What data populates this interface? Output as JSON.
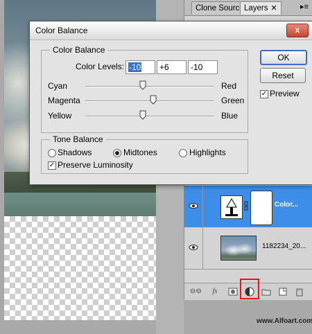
{
  "tabs": {
    "clone_source": "Clone Source",
    "layers": "Layers",
    "close": "✕",
    "more": "▸≡"
  },
  "layers": [
    {
      "name": "Color..."
    },
    {
      "name": "1182234_20..."
    }
  ],
  "dialog": {
    "title": "Color Balance",
    "close": "x",
    "color_balance_legend": "Color Balance",
    "color_levels_label": "Color Levels:",
    "levels": [
      "-10",
      "+6",
      "-10"
    ],
    "sliders": [
      {
        "left": "Cyan",
        "right": "Red",
        "value": -10
      },
      {
        "left": "Magenta",
        "right": "Green",
        "value": 6
      },
      {
        "left": "Yellow",
        "right": "Blue",
        "value": -10
      }
    ],
    "tone_balance_legend": "Tone Balance",
    "tones": [
      "Shadows",
      "Midtones",
      "Highlights"
    ],
    "selected_tone": "Midtones",
    "preserve_luminosity": "Preserve Luminosity",
    "preserve_checked": true,
    "ok": "OK",
    "reset": "Reset",
    "preview": "Preview",
    "preview_checked": true
  },
  "bottom_bar": {
    "link": "⊖⊖",
    "fx": "fx"
  },
  "watermark": "www.Alfoart.com",
  "colors": {
    "selected_layer": "#3d8ee8",
    "highlight": "#e11111"
  }
}
